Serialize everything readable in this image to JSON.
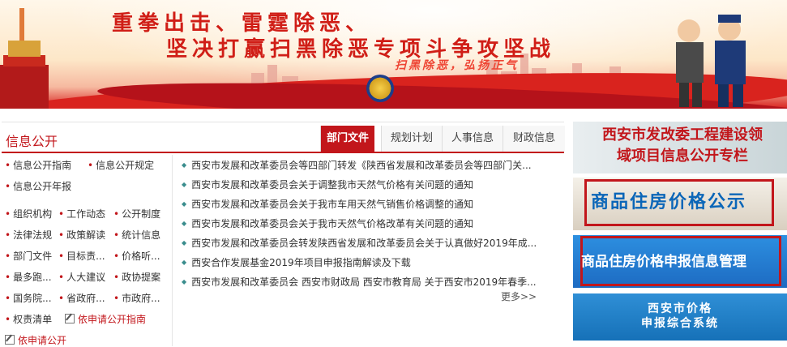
{
  "banner": {
    "slogan_line1": "重拳出击、雷霆除恶、",
    "slogan_line2": "坚决打赢扫黑除恶专项斗争攻坚战",
    "slogan_line3": "扫黑除恶，弘扬正气"
  },
  "info": {
    "title": "信息公开",
    "tabs": [
      {
        "label": "部门文件",
        "active": true
      },
      {
        "label": "规划计划",
        "active": false
      },
      {
        "label": "人事信息",
        "active": false
      },
      {
        "label": "财政信息",
        "active": false
      }
    ],
    "left_links": {
      "guide": "信息公开指南",
      "rules": "信息公开规定",
      "annual": "信息公开年报",
      "org": "组织机构",
      "work": "工作动态",
      "system": "公开制度",
      "law": "法律法规",
      "policy": "政策解读",
      "stats": "统计信息",
      "dept": "部门文件",
      "target": "目标责...",
      "price": "价格听...",
      "most": "最多跑...",
      "npc": "人大建议",
      "cppcc": "政协提案",
      "state": "国务院...",
      "prov": "省政府...",
      "city": "市政府...",
      "power": "权责清单",
      "apply_guide": "依申请公开指南",
      "apply": "依申请公开"
    },
    "news": [
      "西安市发展和改革委员会等四部门转发《陕西省发展和改革委员会等四部门关...",
      "西安市发展和改革委员会关于调整我市天然气价格有关问题的通知",
      "西安市发展和改革委员会关于我市车用天然气销售价格调整的通知",
      "西安市发展和改革委员会关于我市天然气价格改革有关问题的通知",
      "西安市发展和改革委员会转发陕西省发展和改革委员会关于认真做好2019年成...",
      "西安合作发展基金2019年项目申报指南解读及下载",
      "西安市发展和改革委员会 西安市财政局 西安市教育局 关于西安市2019年春季..."
    ],
    "more": "更多>>"
  },
  "right": {
    "banner1": "西安市发改委工程建设领域项目信息公开专栏",
    "banner2": "商品住房价格公示",
    "banner3": "商品住房价格申报信息管理",
    "banner4_line1": "西安市价格",
    "banner4_line2": "申报综合系统"
  },
  "colors": {
    "accent": "#c2161b",
    "blue": "#0b66b8"
  }
}
